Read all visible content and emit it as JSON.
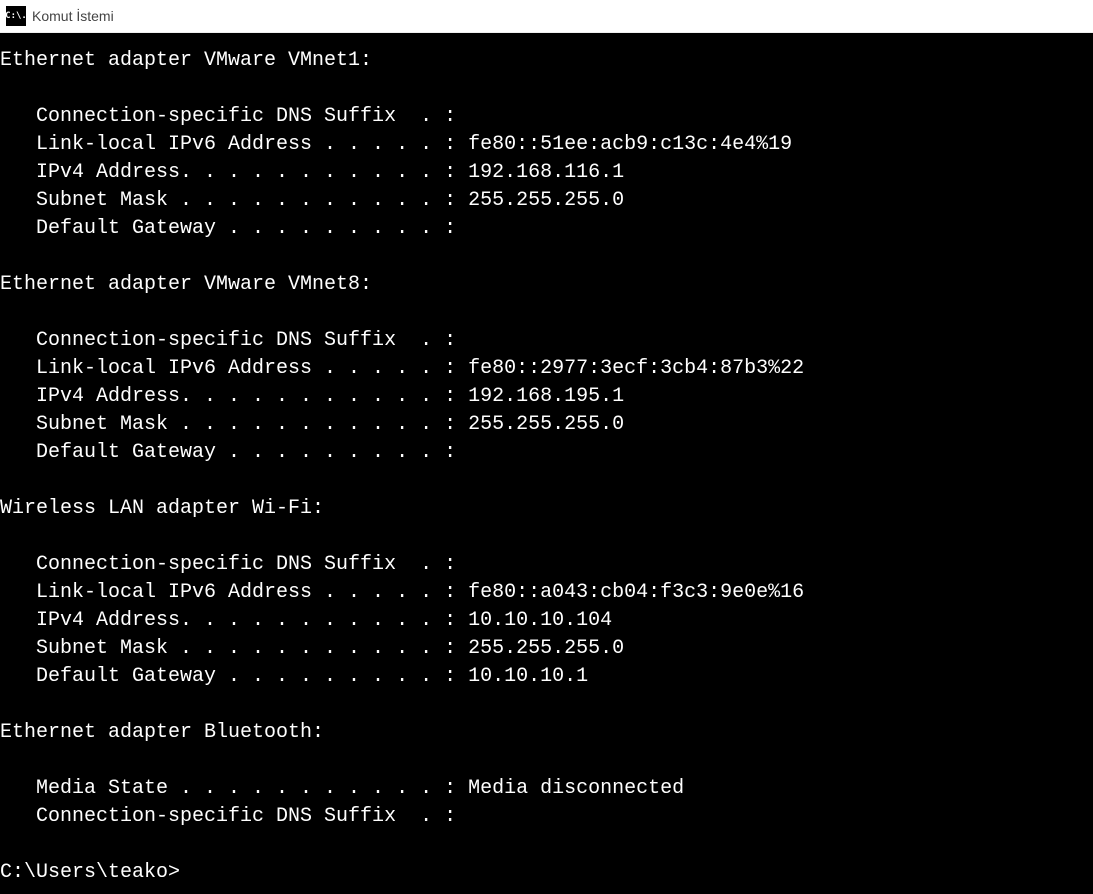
{
  "titlebar": {
    "icon_text": "C:\\.",
    "title": "Komut İstemi"
  },
  "adapters": [
    {
      "header": "Ethernet adapter VMware VMnet1:",
      "rows": [
        {
          "label": "   Connection-specific DNS Suffix  . :",
          "value": ""
        },
        {
          "label": "   Link-local IPv6 Address . . . . . :",
          "value": " fe80::51ee:acb9:c13c:4e4%19"
        },
        {
          "label": "   IPv4 Address. . . . . . . . . . . :",
          "value": " 192.168.116.1"
        },
        {
          "label": "   Subnet Mask . . . . . . . . . . . :",
          "value": " 255.255.255.0"
        },
        {
          "label": "   Default Gateway . . . . . . . . . :",
          "value": ""
        }
      ]
    },
    {
      "header": "Ethernet adapter VMware VMnet8:",
      "rows": [
        {
          "label": "   Connection-specific DNS Suffix  . :",
          "value": ""
        },
        {
          "label": "   Link-local IPv6 Address . . . . . :",
          "value": " fe80::2977:3ecf:3cb4:87b3%22"
        },
        {
          "label": "   IPv4 Address. . . . . . . . . . . :",
          "value": " 192.168.195.1"
        },
        {
          "label": "   Subnet Mask . . . . . . . . . . . :",
          "value": " 255.255.255.0"
        },
        {
          "label": "   Default Gateway . . . . . . . . . :",
          "value": ""
        }
      ]
    },
    {
      "header": "Wireless LAN adapter Wi-Fi:",
      "rows": [
        {
          "label": "   Connection-specific DNS Suffix  . :",
          "value": ""
        },
        {
          "label": "   Link-local IPv6 Address . . . . . :",
          "value": " fe80::a043:cb04:f3c3:9e0e%16"
        },
        {
          "label": "   IPv4 Address. . . . . . . . . . . :",
          "value": " 10.10.10.104"
        },
        {
          "label": "   Subnet Mask . . . . . . . . . . . :",
          "value": " 255.255.255.0"
        },
        {
          "label": "   Default Gateway . . . . . . . . . :",
          "value": " 10.10.10.1"
        }
      ]
    },
    {
      "header": "Ethernet adapter Bluetooth:",
      "rows": [
        {
          "label": "   Media State . . . . . . . . . . . :",
          "value": " Media disconnected"
        },
        {
          "label": "   Connection-specific DNS Suffix  . :",
          "value": ""
        }
      ]
    }
  ],
  "prompt": "C:\\Users\\teako>"
}
